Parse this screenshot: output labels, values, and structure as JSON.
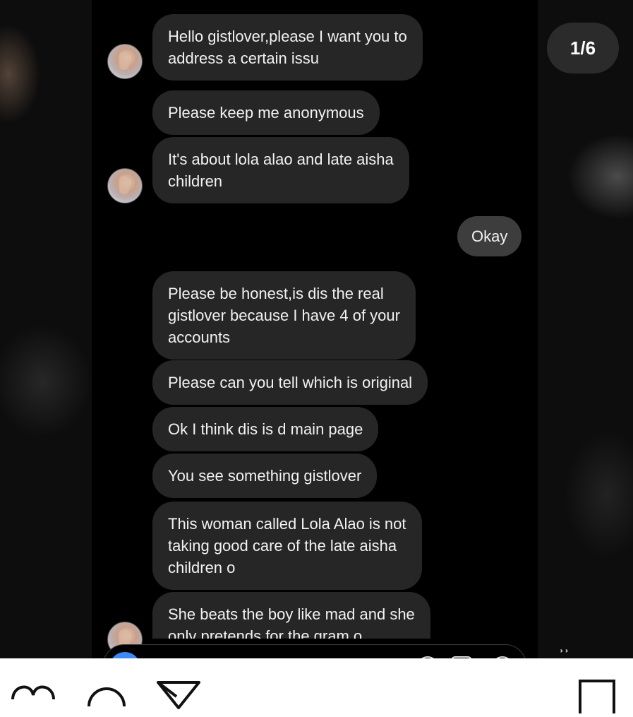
{
  "counter": "1/6",
  "messages": [
    {
      "text": "Hello gistlover,please I want you to\naddress a certain issu",
      "direction": "in"
    },
    {
      "text": "Please keep me anonymous",
      "direction": "in"
    },
    {
      "text": "It's about lola alao and late aisha\nchildren",
      "direction": "in"
    },
    {
      "text": "Okay",
      "direction": "out"
    },
    {
      "text": "Please be honest,is dis the real\ngistlover because I have 4 of your\naccounts",
      "direction": "in"
    },
    {
      "text": "Please can you tell which is original",
      "direction": "in"
    },
    {
      "text": "Ok I think dis is d main page",
      "direction": "in"
    },
    {
      "text": "You see something gistlover",
      "direction": "in"
    },
    {
      "text": "This woman called Lola Alao is not\ntaking good care of the late aisha\nchildren o",
      "direction": "in"
    },
    {
      "text": "She beats the boy like mad and she\nonly pretends for the gram o",
      "direction": "in"
    }
  ],
  "icons": {
    "like": "heart-icon",
    "comment": "comment-icon",
    "share": "send-icon",
    "save": "bookmark-icon",
    "avatar": "avatar-icon",
    "camera": "camera-icon"
  },
  "colors": {
    "chat_background": "#000000",
    "incoming_bubble": "#262626",
    "outgoing_bubble": "#3d3d3d",
    "camera_accent": "#3d8af7"
  }
}
